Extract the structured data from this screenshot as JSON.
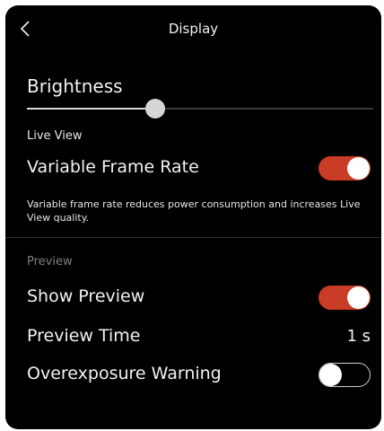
{
  "header": {
    "title": "Display",
    "back_icon": "chevron-left-icon"
  },
  "brightness": {
    "label": "Brightness",
    "value_fraction": 0.37
  },
  "live_view": {
    "section_label": "Live View",
    "variable_frame_rate": {
      "label": "Variable Frame Rate",
      "enabled": true
    },
    "description": "Variable frame rate reduces power consumption and increases Live View quality."
  },
  "preview": {
    "section_label": "Preview",
    "show_preview": {
      "label": "Show Preview",
      "enabled": true
    },
    "preview_time": {
      "label": "Preview Time",
      "value": "1 s"
    },
    "overexposure_warning": {
      "label": "Overexposure Warning",
      "enabled": false
    }
  },
  "colors": {
    "toggle_on": "#c93c25",
    "background": "#000000",
    "text": "#f2f2f2"
  }
}
